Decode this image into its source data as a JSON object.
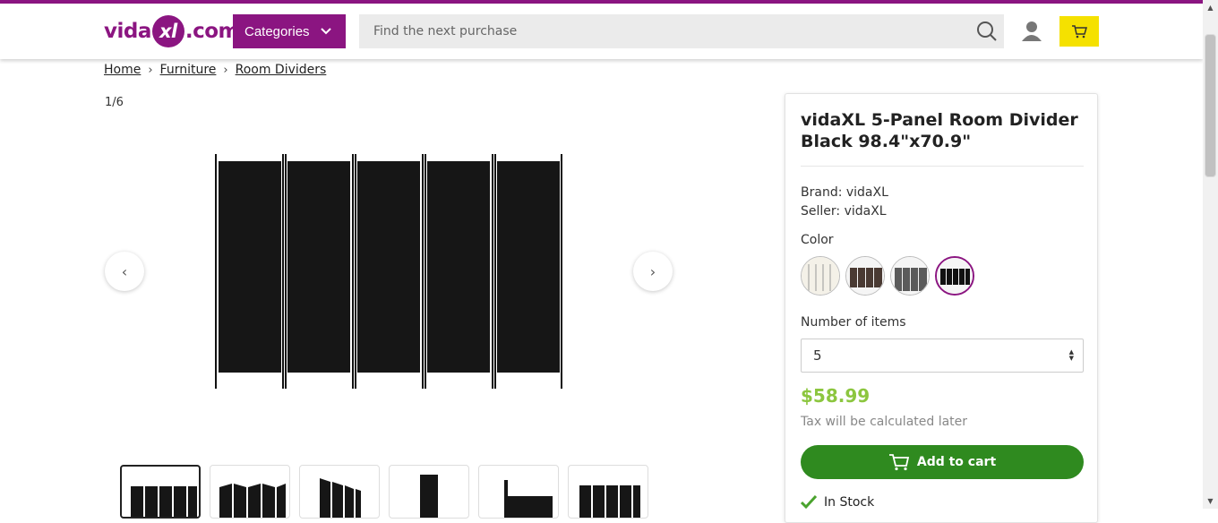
{
  "header": {
    "logo": {
      "part1": "vida",
      "part2": "xl",
      "part3": ".com"
    },
    "categories_label": "Categories",
    "search_placeholder": "Find the next purchase",
    "brand_color": "#8b1581",
    "cart_color": "#f5e100"
  },
  "breadcrumb": [
    {
      "label": "Home"
    },
    {
      "label": "Furniture"
    },
    {
      "label": "Room Dividers"
    }
  ],
  "breadcrumb_separator": "›",
  "gallery": {
    "counter": "1/6",
    "prev_icon": "‹",
    "next_icon": "›"
  },
  "product": {
    "title": "vidaXL 5-Panel Room Divider Black 98.4\"x70.9\"",
    "brand_line": "Brand: vidaXL",
    "seller_line": "Seller: vidaXL",
    "color_label": "Color",
    "colors": [
      "cream",
      "brown",
      "anthracite",
      "black"
    ],
    "selected_color_index": 3,
    "quantity_label": "Number of items",
    "quantity_value": "5",
    "price": "$58.99",
    "price_color": "#8cc63f",
    "tax_note": "Tax will be calculated later",
    "add_to_cart": "Add to cart",
    "button_color": "#2f8a1f",
    "stock": "In Stock"
  }
}
